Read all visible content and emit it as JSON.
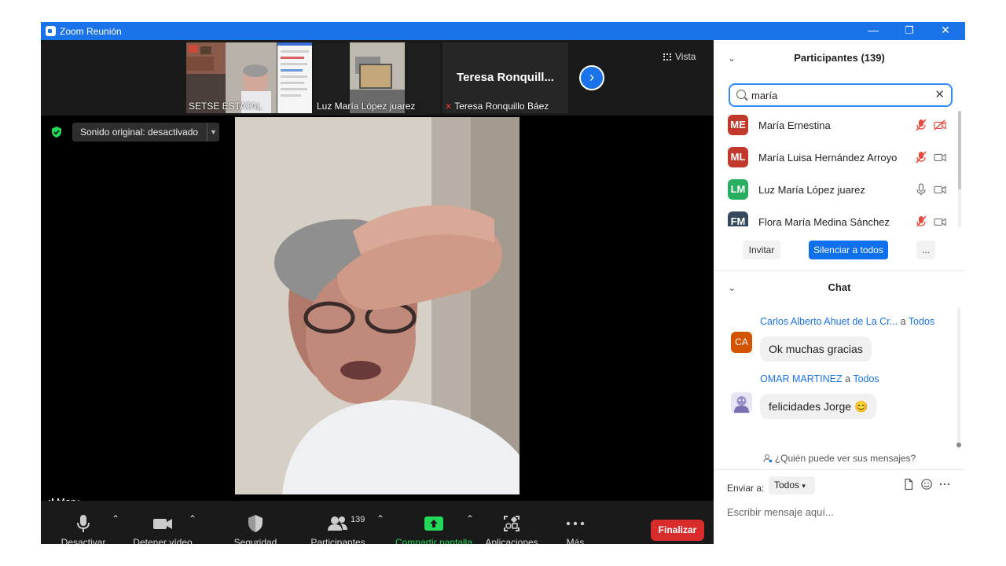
{
  "window": {
    "title": "Zoom Reunión",
    "minimize": "—",
    "restore": "❐",
    "close": "✕"
  },
  "stage": {
    "thumbnails": [
      {
        "name": "SETSE ESTATAL"
      },
      {
        "name": "Luz María López juarez"
      },
      {
        "name": "Teresa Ronquillo Báez",
        "big_name": "Teresa  Ronquill..."
      }
    ],
    "view_label": "Vista",
    "sound_label": "Sonido original: desactivado",
    "speaker": "Mary"
  },
  "toolbar": {
    "audio": "Desactivar audio",
    "video": "Detener vídeo",
    "security": "Seguridad",
    "participants": "Participantes",
    "participants_count": "139",
    "share": "Compartir pantalla",
    "apps": "Aplicaciones",
    "more": "Más",
    "end": "Finalizar"
  },
  "participants_panel": {
    "title": "Participantes (139)",
    "search_value": "maría",
    "participants": [
      {
        "initials": "ME",
        "name": "María Ernestina",
        "color": "#c0392b",
        "mic": "muted",
        "cam": "off"
      },
      {
        "initials": "ML",
        "name": "María Luisa Hernández Arroyo",
        "color": "#c0392b",
        "mic": "muted",
        "cam": "on"
      },
      {
        "initials": "LM",
        "name": "Luz María López juarez",
        "color": "#27ae60",
        "mic": "on",
        "cam": "on"
      },
      {
        "initials": "FM",
        "name": "Flora María Medina Sánchez",
        "color": "#34495e",
        "mic": "muted",
        "cam": "on"
      }
    ],
    "invite": "Invitar",
    "mute_all": "Silenciar a todos",
    "more": "..."
  },
  "chat": {
    "title": "Chat",
    "to_word": "a",
    "messages": [
      {
        "sender": "Carlos Alberto Ahuet de La Cr...",
        "to": "Todos",
        "text": "Ok muchas gracias",
        "avatar": "CA",
        "avatar_color": "#d35400"
      },
      {
        "sender": "OMAR MARTINEZ",
        "to": "Todos",
        "text": "felicidades Jorge 😊",
        "avatar": "",
        "avatar_color": "#9b8fc9"
      }
    ],
    "who_can_see": "¿Quién puede ver sus mensajes?",
    "send_to_label": "Enviar a:",
    "send_to_value": "Todos",
    "placeholder": "Escribir mensaje aquí..."
  }
}
